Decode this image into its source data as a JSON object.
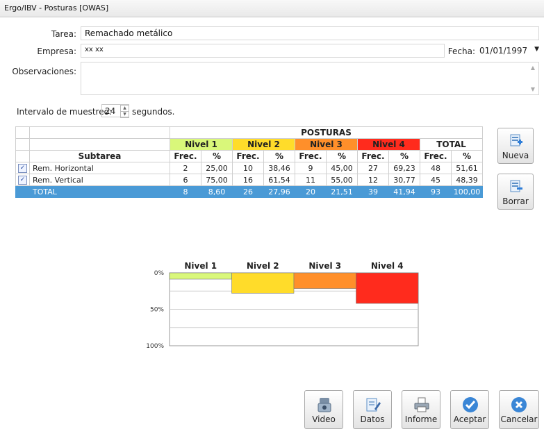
{
  "window": {
    "title": "Ergo/IBV - Posturas [OWAS]"
  },
  "form": {
    "tarea_label": "Tarea:",
    "tarea_value": "Remachado metálico",
    "empresa_label": "Empresa:",
    "empresa_value": "xx xx",
    "fecha_label": "Fecha:",
    "fecha_value": "01/01/1997",
    "observaciones_label": "Observaciones:",
    "intervalo_label": "Intervalo de muestreo:",
    "intervalo_value": "24",
    "intervalo_unit": "segundos."
  },
  "table": {
    "group_header": "POSTURAS",
    "subtarea_header": "Subtarea",
    "levels": [
      "Nivel 1",
      "Nivel 2",
      "Nivel 3",
      "Nivel 4",
      "TOTAL"
    ],
    "sub_headers": [
      "Frec.",
      "%",
      "Frec.",
      "%",
      "Frec.",
      "%",
      "Frec.",
      "%",
      "Frec.",
      "%"
    ],
    "rows": [
      {
        "checked": true,
        "name": "Rem. Horizontal",
        "cells": [
          "2",
          "25,00",
          "10",
          "38,46",
          "9",
          "45,00",
          "27",
          "69,23",
          "48",
          "51,61"
        ]
      },
      {
        "checked": true,
        "name": "Rem. Vertical",
        "cells": [
          "6",
          "75,00",
          "16",
          "61,54",
          "11",
          "55,00",
          "12",
          "30,77",
          "45",
          "48,39"
        ]
      }
    ],
    "total": {
      "name": "TOTAL",
      "cells": [
        "8",
        "8,60",
        "26",
        "27,96",
        "20",
        "21,51",
        "39",
        "41,94",
        "93",
        "100,00"
      ]
    }
  },
  "side_buttons": {
    "nueva": "Nueva",
    "borrar": "Borrar"
  },
  "chart_data": {
    "type": "bar",
    "categories": [
      "Nivel 1",
      "Nivel 2",
      "Nivel 3",
      "Nivel 4"
    ],
    "values": [
      8.6,
      27.96,
      21.51,
      41.94
    ],
    "yticks": [
      "0%",
      "50%",
      "100%"
    ],
    "ylim": [
      0,
      100
    ],
    "colors": [
      "#d9f77a",
      "#ffdc2a",
      "#ff8f2a",
      "#ff2b1d"
    ]
  },
  "bottom_buttons": {
    "video": "Video",
    "datos": "Datos",
    "informe": "Informe",
    "aceptar": "Aceptar",
    "cancelar": "Cancelar"
  }
}
